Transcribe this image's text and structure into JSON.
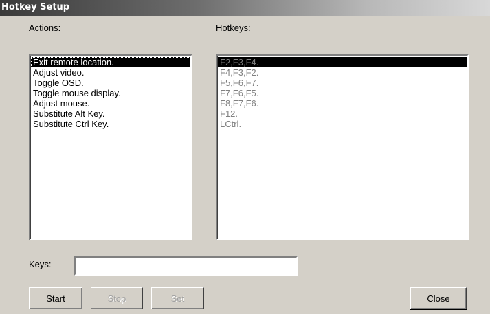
{
  "window": {
    "title": "Hotkey Setup"
  },
  "actions": {
    "label": "Actions:",
    "items": [
      "Exit remote location.",
      "Adjust video.",
      "Toggle OSD.",
      "Toggle mouse display.",
      "Adjust mouse.",
      "Substitute Alt Key.",
      "Substitute Ctrl Key."
    ],
    "selected_index": 0
  },
  "hotkeys": {
    "label": "Hotkeys:",
    "items": [
      "F2,F3,F4.",
      "F4,F3,F2.",
      "F5,F6,F7.",
      "F7,F6,F5.",
      "F8,F7,F6.",
      "F12.",
      "LCtrl."
    ],
    "selected_index": 0
  },
  "keys": {
    "label": "Keys:",
    "value": ""
  },
  "buttons": {
    "start": "Start",
    "stop": "Stop",
    "set": "Set",
    "close": "Close"
  }
}
